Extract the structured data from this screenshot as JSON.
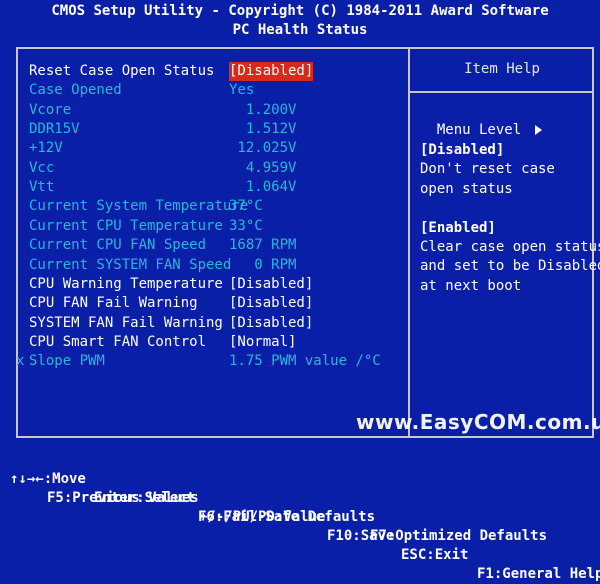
{
  "header": {
    "title": "CMOS Setup Utility - Copyright (C) 1984-2011 Award Software",
    "page": "PC Health Status"
  },
  "rows": [
    {
      "label": "Reset Case Open Status",
      "value": "[Disabled]",
      "state": "enabled",
      "selected": true,
      "mark": ""
    },
    {
      "label": "Case Opened",
      "value": "Yes",
      "state": "disabled",
      "mark": ""
    },
    {
      "label": "Vcore",
      "value": "  1.200V",
      "state": "disabled",
      "mark": ""
    },
    {
      "label": "DDR15V",
      "value": "  1.512V",
      "state": "disabled",
      "mark": ""
    },
    {
      "label": "+12V",
      "value": " 12.025V",
      "state": "disabled",
      "mark": ""
    },
    {
      "label": "Vcc",
      "value": "  4.959V",
      "state": "disabled",
      "mark": ""
    },
    {
      "label": "Vtt",
      "value": "  1.064V",
      "state": "disabled",
      "mark": ""
    },
    {
      "label": "Current System Temperature",
      "value": "37°C",
      "state": "disabled",
      "mark": ""
    },
    {
      "label": "Current CPU Temperature",
      "value": "33°C",
      "state": "disabled",
      "mark": ""
    },
    {
      "label": "Current CPU FAN Speed",
      "value": "1687 RPM",
      "state": "disabled",
      "mark": ""
    },
    {
      "label": "Current SYSTEM FAN Speed",
      "value": "   0 RPM",
      "state": "disabled",
      "mark": ""
    },
    {
      "label": "CPU Warning Temperature",
      "value": "[Disabled]",
      "state": "enabled",
      "mark": ""
    },
    {
      "label": "CPU FAN Fail Warning",
      "value": "[Disabled]",
      "state": "enabled",
      "mark": ""
    },
    {
      "label": "SYSTEM FAN Fail Warning",
      "value": "[Disabled]",
      "state": "enabled",
      "mark": ""
    },
    {
      "label": "CPU Smart FAN Control",
      "value": "[Normal]",
      "state": "enabled",
      "mark": ""
    },
    {
      "label": "Slope PWM",
      "value": "1.75 PWM value /°C",
      "state": "disabled",
      "mark": "x"
    }
  ],
  "help": {
    "title": "Item Help",
    "menu_level": "Menu Level",
    "lines": [
      {
        "text": "[Disabled]",
        "head": true
      },
      {
        "text": "Don't reset case",
        "head": false
      },
      {
        "text": "open status",
        "head": false
      },
      {
        "text": "",
        "head": false
      },
      {
        "text": "[Enabled]",
        "head": true
      },
      {
        "text": "Clear case open status",
        "head": false
      },
      {
        "text": "and set to be Disabled",
        "head": false
      },
      {
        "text": "at next boot",
        "head": false
      }
    ]
  },
  "watermark": "www.EasyCOM.com.ua",
  "footer": {
    "line1": [
      {
        "key": "↑↓→←:Move",
        "name": "move"
      },
      {
        "key": "Enter:Select",
        "name": "select"
      },
      {
        "key": "+/-/PU/PD:Value",
        "name": "value"
      },
      {
        "key": "F10:Save",
        "name": "save"
      },
      {
        "key": "ESC:Exit",
        "name": "exit"
      },
      {
        "key": "F1:General Help",
        "name": "general-help"
      }
    ],
    "line2": [
      {
        "key": "F5:Previous Values",
        "name": "previous-values"
      },
      {
        "key": "F6:Fail-Safe Defaults",
        "name": "fail-safe-defaults"
      },
      {
        "key": "F7:Optimized Defaults",
        "name": "optimized-defaults"
      }
    ]
  },
  "colors": {
    "background": "#0a1fa8",
    "enabled_text": "#ffffff",
    "disabled_text": "#27b7d6",
    "highlight": "#d72a1c",
    "frame": "#c8c8c8"
  }
}
